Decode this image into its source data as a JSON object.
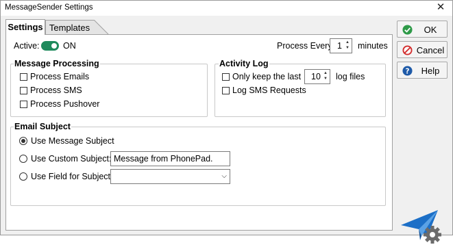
{
  "window": {
    "title": "MessageSender Settings",
    "close_glyph": "✕"
  },
  "tabs": [
    {
      "label": "Settings",
      "selected": true
    },
    {
      "label": "Templates",
      "selected": false
    }
  ],
  "general": {
    "active_label": "Active:",
    "toggle_state": "ON",
    "process_every_label": "Process Every",
    "process_every_value": "1",
    "minutes_label": "minutes"
  },
  "message_processing": {
    "title": "Message Processing",
    "items": [
      {
        "label": "Process Emails",
        "checked": false
      },
      {
        "label": "Process SMS",
        "checked": false
      },
      {
        "label": "Process Pushover",
        "checked": false
      }
    ]
  },
  "activity_log": {
    "title": "Activity Log",
    "keep_last_label": "Only keep the last",
    "keep_last_value": "10",
    "log_files_label": "log files",
    "log_sms_label": "Log SMS Requests"
  },
  "email_subject": {
    "title": "Email Subject",
    "use_message_subject": "Use Message Subject",
    "use_custom_subject": "Use Custom Subject:",
    "custom_subject_value": "Message from PhonePad.",
    "use_field_for_subject": "Use Field for Subject:",
    "field_value": "",
    "selected": "use_message_subject"
  },
  "buttons": {
    "ok": "OK",
    "cancel": "Cancel",
    "help": "Help"
  },
  "colors": {
    "toggle_on": "#1f8a5c",
    "ok_icon": "#2e9a48",
    "cancel_icon": "#d32f2f",
    "help_icon": "#1e5aa8",
    "logo_blue": "#1c6fc7",
    "logo_gear": "#6b6b6b"
  },
  "icons": {
    "ok": "check-circle-icon",
    "cancel": "no-entry-icon",
    "help": "question-icon",
    "logo": "paper-plane-gear-logo"
  }
}
